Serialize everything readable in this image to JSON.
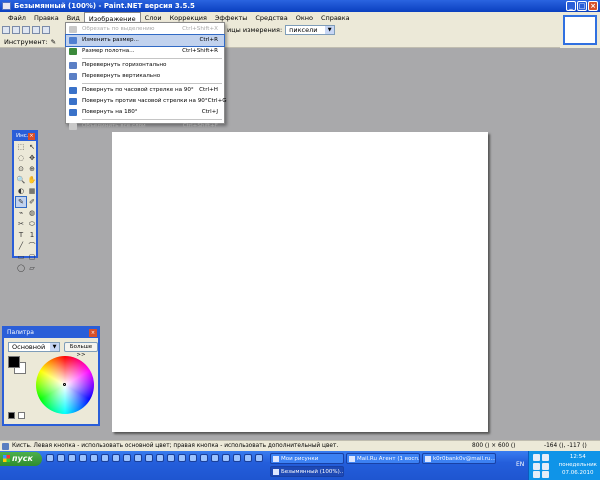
{
  "window": {
    "title": "Безымянный (100%) - Paint.NET версия 3.5.5",
    "buttons": [
      "_",
      "□",
      "×"
    ]
  },
  "menubar": {
    "items": [
      "Файл",
      "Правка",
      "Вид",
      "Изображение",
      "Слои",
      "Коррекция",
      "Эффекты",
      "Средства",
      "Окно",
      "Справка"
    ],
    "active": "Изображение"
  },
  "toolbar": {
    "units_label": "ицы измерения:",
    "units_value": "пиксели",
    "tool_label": "Инструмент:"
  },
  "image_menu": {
    "items": [
      {
        "label": "Обрезать по выделению",
        "shortcut": "Ctrl+Shift+X",
        "disabled": true,
        "icon_color": "#c9c9c9"
      },
      {
        "label": "Изменить размер...",
        "shortcut": "Ctrl+R",
        "disabled": false,
        "hover": true,
        "icon_color": "#4f7fd0"
      },
      {
        "label": "Размер полотна...",
        "shortcut": "Ctrl+Shift+R",
        "disabled": false,
        "icon_color": "#3b8a3b"
      },
      {
        "label": "Перевернуть горизонтально",
        "shortcut": "",
        "disabled": false,
        "icon_color": "#5b7fc5",
        "sep_before": true
      },
      {
        "label": "Перевернуть вертикально",
        "shortcut": "",
        "disabled": false,
        "icon_color": "#5b7fc5"
      },
      {
        "label": "Повернуть по часовой стрелке на 90°",
        "shortcut": "Ctrl+H",
        "disabled": false,
        "icon_color": "#3a72c9",
        "sep_before": true
      },
      {
        "label": "Повернуть против часовой стрелки на 90°",
        "shortcut": "Ctrl+G",
        "disabled": false,
        "icon_color": "#3a72c9"
      },
      {
        "label": "Повернуть на 180°",
        "shortcut": "Ctrl+J",
        "disabled": false,
        "icon_color": "#3a72c9"
      },
      {
        "label": "Объединить все слои",
        "shortcut": "Ctrl+Shift+F",
        "disabled": true,
        "icon_color": "#c9c9c9",
        "sep_before": true
      }
    ]
  },
  "tools_window": {
    "title": "Инс...",
    "tools": [
      "⬚",
      "↖",
      "◌",
      "✥",
      "⊙",
      "⊕",
      "🔍",
      "✋",
      "◐",
      "▦",
      "✎",
      "✐",
      "⌁",
      "◍",
      "✂",
      "⬭",
      "T",
      "1",
      "╱",
      "⌒",
      "▭",
      "▢",
      "◯",
      "▱"
    ],
    "selected_index": 10
  },
  "palette": {
    "title": "Палитра",
    "mode": "Основной",
    "more_button": "Больше >>",
    "primary_color": "#000000",
    "secondary_color": "#ffffff"
  },
  "statusbar": {
    "hint": "Кисть. Левая кнопка - использовать основной цвет; правая кнопка - использовать дополнительный цвет.",
    "size": "800 () × 600 ()",
    "coords": "-164 (), -117 ()"
  },
  "taskbar": {
    "start_label": "пуск",
    "tasks": [
      {
        "label": "Мои рисунки",
        "active": false
      },
      {
        "label": "Mail.Ru Агент (1 восп...",
        "active": false
      },
      {
        "label": "k0r0bank0v@mail.ru...",
        "active": false
      },
      {
        "label": "Безымянный (100%)...",
        "active": true
      }
    ],
    "lang": "EN",
    "time": "12:54",
    "day": "понедельник",
    "date": "07.06.2010"
  }
}
